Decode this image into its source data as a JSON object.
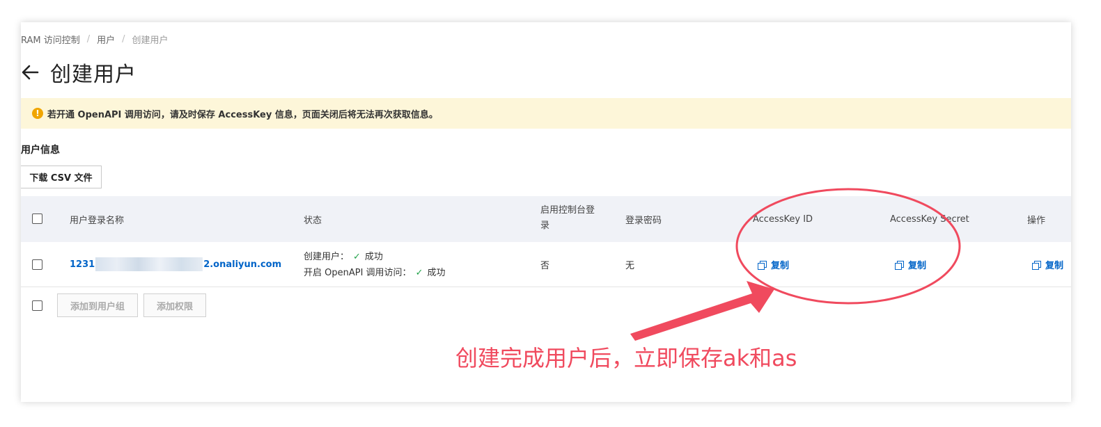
{
  "breadcrumb": {
    "items": [
      "RAM 访问控制",
      "用户",
      "创建用户"
    ],
    "separator": "/"
  },
  "page": {
    "title": "创建用户",
    "back_icon": "arrow-left-icon"
  },
  "alert": {
    "icon": "warning-icon",
    "icon_char": "!",
    "text": "若开通 OpenAPI 调用访问，请及时保存 AccessKey 信息，页面关闭后将无法再次获取信息。",
    "color": "#fdf6d9"
  },
  "section": {
    "title": "用户信息",
    "download_label": "下载 CSV 文件"
  },
  "table": {
    "headers": {
      "login_name": "用户登录名称",
      "status": "状态",
      "console_login": "启用控制台登录",
      "password": "登录密码",
      "ak_id": "AccessKey ID",
      "ak_secret": "AccessKey Secret",
      "actions": "操作"
    },
    "rows": [
      {
        "login_name_prefix": "1231",
        "login_name_suffix": "2.onaliyun.com",
        "status_create_label": "创建用户：",
        "status_create_value": "成功",
        "status_openapi_label": "开启 OpenAPI 调用访问：",
        "status_openapi_value": "成功",
        "console_login": "否",
        "password": "无",
        "ak_id_action": "复制",
        "ak_secret_action": "复制",
        "row_action": "复制"
      }
    ]
  },
  "footer_buttons": {
    "add_to_group": "添加到用户组",
    "add_permission": "添加权限"
  },
  "annotation": {
    "text": "创建完成用户后，立即保存ak和as",
    "color": "#f04a5e"
  },
  "colors": {
    "link": "#0064c8",
    "success": "#22a34a",
    "header_bg": "#f0f2f7"
  }
}
